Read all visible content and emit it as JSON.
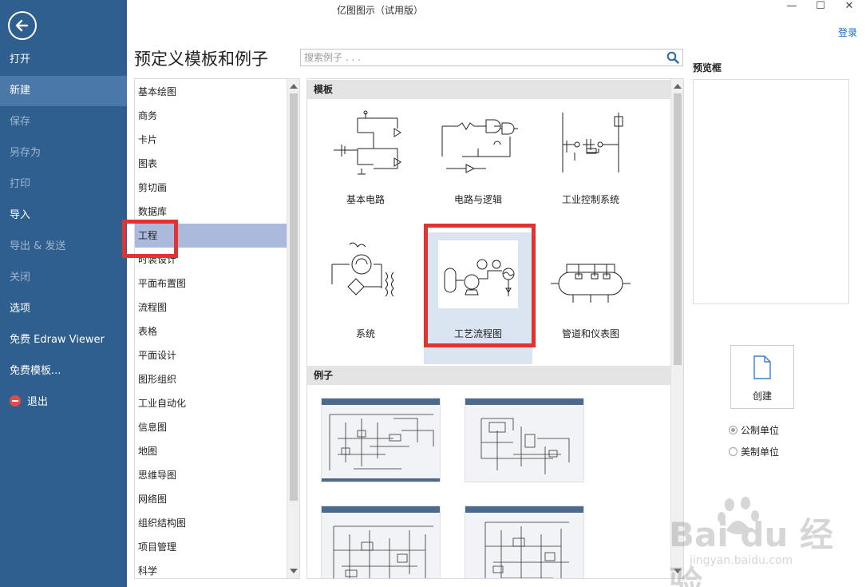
{
  "window": {
    "title": "亿图图示（试用版）",
    "controls": [
      "—",
      "☐",
      "✕"
    ],
    "login_label": "登录"
  },
  "sidebar": {
    "items": [
      {
        "label": "打开",
        "state": "normal"
      },
      {
        "label": "新建",
        "state": "active"
      },
      {
        "label": "保存",
        "state": "disabled"
      },
      {
        "label": "另存为",
        "state": "disabled"
      },
      {
        "label": "打印",
        "state": "disabled"
      },
      {
        "label": "导入",
        "state": "normal"
      },
      {
        "label": "导出 & 发送",
        "state": "disabled"
      },
      {
        "label": "关闭",
        "state": "disabled"
      },
      {
        "label": "选项",
        "state": "normal"
      },
      {
        "label": "免费 Edraw Viewer",
        "state": "normal"
      },
      {
        "label": "免费模板...",
        "state": "normal"
      },
      {
        "label": "退出",
        "state": "normal",
        "icon": "exit-icon"
      }
    ]
  },
  "main": {
    "heading": "预定义模板和例子",
    "search_placeholder": "搜索例子 . . ."
  },
  "categories": [
    "基本绘图",
    "商务",
    "卡片",
    "图表",
    "剪切画",
    "数据库",
    "工程",
    "时装设计",
    "平面布置图",
    "流程图",
    "表格",
    "平面设计",
    "图形组织",
    "工业自动化",
    "信息图",
    "地图",
    "思维导图",
    "网络图",
    "组织结构图",
    "项目管理",
    "科学"
  ],
  "selected_category": "工程",
  "templates": {
    "section_title": "模板",
    "items": [
      "基本电路",
      "电路与逻辑",
      "工业控制系统",
      "系统",
      "工艺流程图",
      "管道和仪表图"
    ],
    "selected": "工艺流程图"
  },
  "examples": {
    "section_title": "例子"
  },
  "preview": {
    "label": "预览框",
    "create_label": "创建",
    "units": [
      {
        "label": "公制单位",
        "selected": true
      },
      {
        "label": "美制单位",
        "selected": false
      }
    ]
  },
  "watermark": {
    "text": "Bai du 经验",
    "sub": "jingyan.baidu.com"
  },
  "colors": {
    "sidebar": "#2f5f8f",
    "sidebar_active": "#4a78a8",
    "selected_category": "#aab9dc",
    "highlight": "#e23232",
    "link": "#1a6fc2"
  }
}
